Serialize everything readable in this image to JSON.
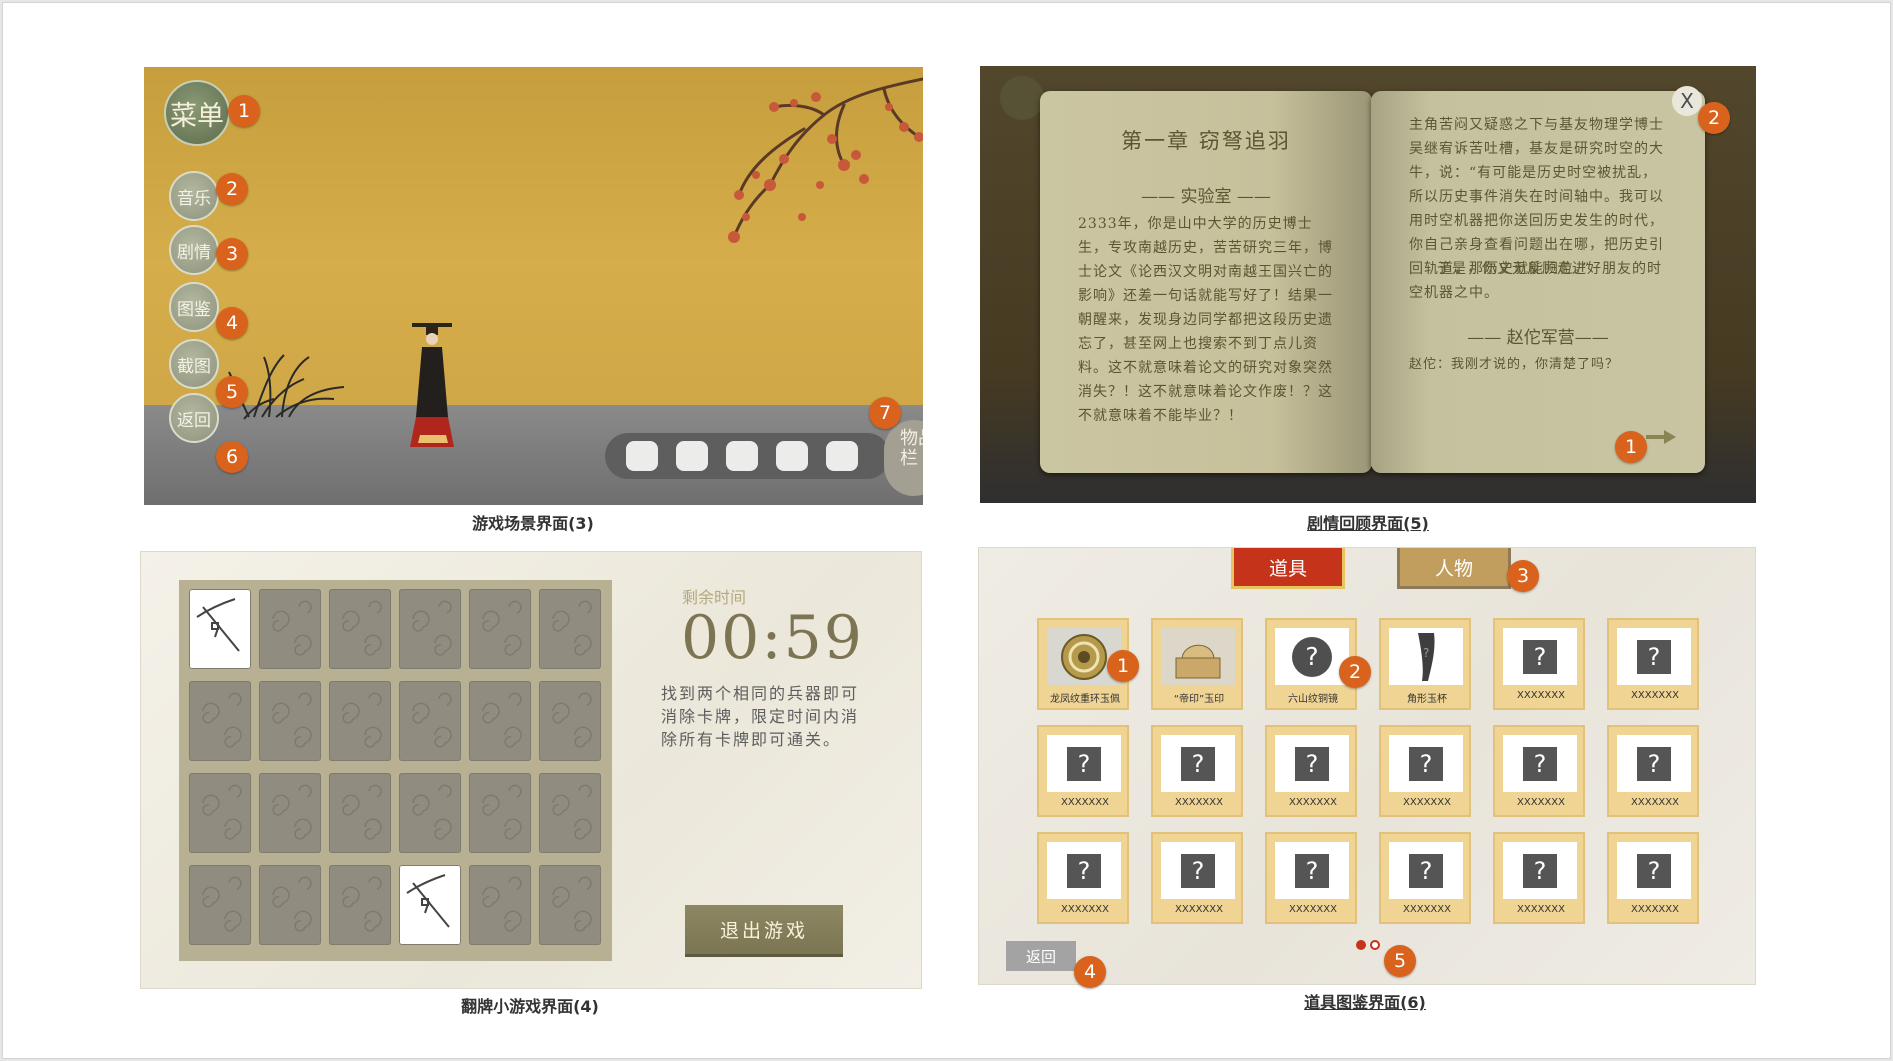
{
  "panels": {
    "scene": {
      "caption": "游戏场景界面(3)",
      "menu_label": "菜单",
      "buttons": [
        "音乐",
        "剧情",
        "图鉴",
        "截图",
        "返回"
      ],
      "inventory_label": "物品栏",
      "badges": [
        "1",
        "2",
        "3",
        "4",
        "5",
        "6",
        "7"
      ]
    },
    "story": {
      "caption": "剧情回顾界面(5)",
      "chapter_title": "第一章 窃弩追羽",
      "section_title": "—— 实验室 ——",
      "left_text": "2333年，你是山中大学的历史博士生，专攻南越历史，苦苦研究三年，博士论文《论西汉文明对南越王国兴亡的影响》还差一句话就能写好了！结果一朝醒来，发现身边同学都把这段历史遗忘了，甚至网上也搜索不到丁点儿资料。这不就意味着论文的研究对象突然消失？！这不就意味着论文作废！？这不就意味着不能毕业？！",
      "right_text_1": "主角苦闷又疑惑之下与基友物理学博士吴继宥诉苦吐槽，基友是研究时空的大牛，说：“有可能是历史时空被扰乱，所以历史事件消失在时间轴中。我可以用时空机器把你送回历史发生的时代，你自己亲身查看问题出在哪，把历史引回轨道，那历史就能归位。”",
      "right_text_2": "于是，你义无反顾走进好朋友的时空机器之中。",
      "speaker_title": "—— 赵佗军营——",
      "dialogue": "赵佗：我刚才说的，你清楚了吗？",
      "close_label": "X",
      "badges": [
        "1",
        "2"
      ]
    },
    "minigame": {
      "caption": "翻牌小游戏界面(4)",
      "timer_label": "剩余时间",
      "timer": "00:59",
      "hint": "找到两个相同的兵器即可消除卡牌，限定时间内消除所有卡牌即可通关。",
      "quit_label": "退出游戏",
      "face_up_cards": [
        [
          0,
          0
        ],
        [
          3,
          3
        ]
      ]
    },
    "collection": {
      "caption": "道具图鉴界面(6)",
      "tabs": [
        "道具",
        "人物"
      ],
      "items": [
        {
          "label": "龙凤纹重环玉佩",
          "kind": "jade-disc"
        },
        {
          "label": "“帝印”玉印",
          "kind": "jade-seal"
        },
        {
          "label": "六山纹铜镜",
          "kind": "unknown-circle"
        },
        {
          "label": "角形玉杯",
          "kind": "horn-cup"
        },
        {
          "label": "XXXXXXX",
          "kind": "unknown"
        },
        {
          "label": "XXXXXXX",
          "kind": "unknown"
        },
        {
          "label": "XXXXXXX",
          "kind": "unknown"
        },
        {
          "label": "XXXXXXX",
          "kind": "unknown"
        },
        {
          "label": "XXXXXXX",
          "kind": "unknown"
        },
        {
          "label": "XXXXXXX",
          "kind": "unknown"
        },
        {
          "label": "XXXXXXX",
          "kind": "unknown"
        },
        {
          "label": "XXXXXXX",
          "kind": "unknown"
        },
        {
          "label": "XXXXXXX",
          "kind": "unknown"
        },
        {
          "label": "XXXXXXX",
          "kind": "unknown"
        },
        {
          "label": "XXXXXXX",
          "kind": "unknown"
        },
        {
          "label": "XXXXXXX",
          "kind": "unknown"
        },
        {
          "label": "XXXXXXX",
          "kind": "unknown"
        },
        {
          "label": "XXXXXXX",
          "kind": "unknown"
        }
      ],
      "unknown_mark": "?",
      "back_label": "返回",
      "page_count": 2,
      "current_page": 1,
      "badges": [
        "1",
        "2",
        "3",
        "4",
        "5"
      ]
    }
  },
  "colors": {
    "badge": "#d9631c",
    "scene_bg": "#cda345",
    "book_page": "#c8c4a0",
    "tab_active": "#c5331b",
    "tab_inactive": "#c19d5e",
    "collection_cell": "#efd494",
    "quit_button": "#857f5b"
  }
}
